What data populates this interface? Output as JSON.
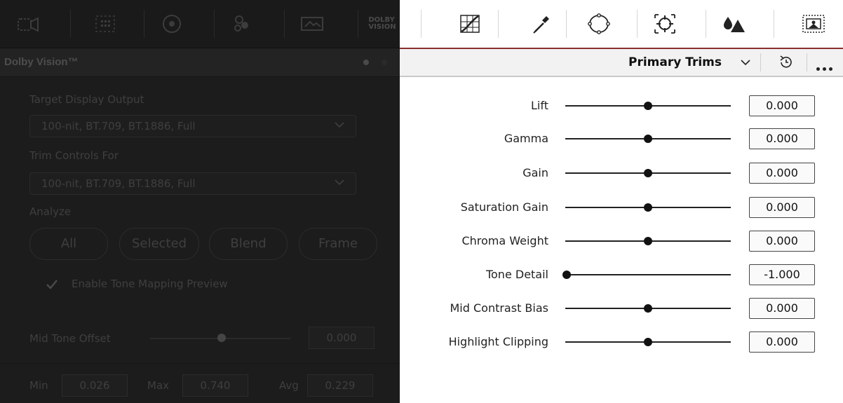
{
  "left_panel": {
    "title": "Dolby Vision™",
    "dolby_logo_line1": "DOLBY",
    "dolby_logo_line2": "VISION",
    "target_display_output_label": "Target Display Output",
    "target_display_output_value": "100-nit, BT.709, BT.1886, Full",
    "trim_controls_for_label": "Trim Controls For",
    "trim_controls_for_value": "100-nit, BT.709, BT.1886, Full",
    "analyze_label": "Analyze",
    "analyze_buttons": [
      "All",
      "Selected",
      "Blend",
      "Frame"
    ],
    "enable_tone_mapping_label": "Enable Tone Mapping Preview",
    "enable_tone_mapping_checked": true,
    "mid_tone_offset_label": "Mid Tone Offset",
    "mid_tone_offset_value": "0.000",
    "stats": {
      "min_label": "Min",
      "min_value": "0.026",
      "max_label": "Max",
      "max_value": "0.740",
      "avg_label": "Avg",
      "avg_value": "0.229"
    }
  },
  "right_panel": {
    "mode_title": "Primary Trims",
    "sliders": [
      {
        "label": "Lift",
        "value": "0.000",
        "level": 0.5
      },
      {
        "label": "Gamma",
        "value": "0.000",
        "level": 0.5
      },
      {
        "label": "Gain",
        "value": "0.000",
        "level": 0.5
      },
      {
        "label": "Saturation Gain",
        "value": "0.000",
        "level": 0.5
      },
      {
        "label": "Chroma Weight",
        "value": "0.000",
        "level": 0.5
      },
      {
        "label": "Tone Detail",
        "value": "-1.000",
        "level": 0.0
      },
      {
        "label": "Mid Contrast Bias",
        "value": "0.000",
        "level": 0.5
      },
      {
        "label": "Highlight Clipping",
        "value": "0.000",
        "level": 0.5
      }
    ]
  },
  "toolbar_icons_left": [
    "camera-raw-icon",
    "color-match-icon",
    "primaries-wheels-icon",
    "rgb-mixer-icon",
    "hdr-icon",
    "dolby-vision-icon"
  ],
  "toolbar_icons_right": [
    "curves-icon",
    "qualifier-icon",
    "window-icon",
    "tracker-icon",
    "blur-icon",
    "key-icon"
  ],
  "colors": {
    "accent_red": "#8a2f2f",
    "dim_bg": "#1c1c1d"
  }
}
